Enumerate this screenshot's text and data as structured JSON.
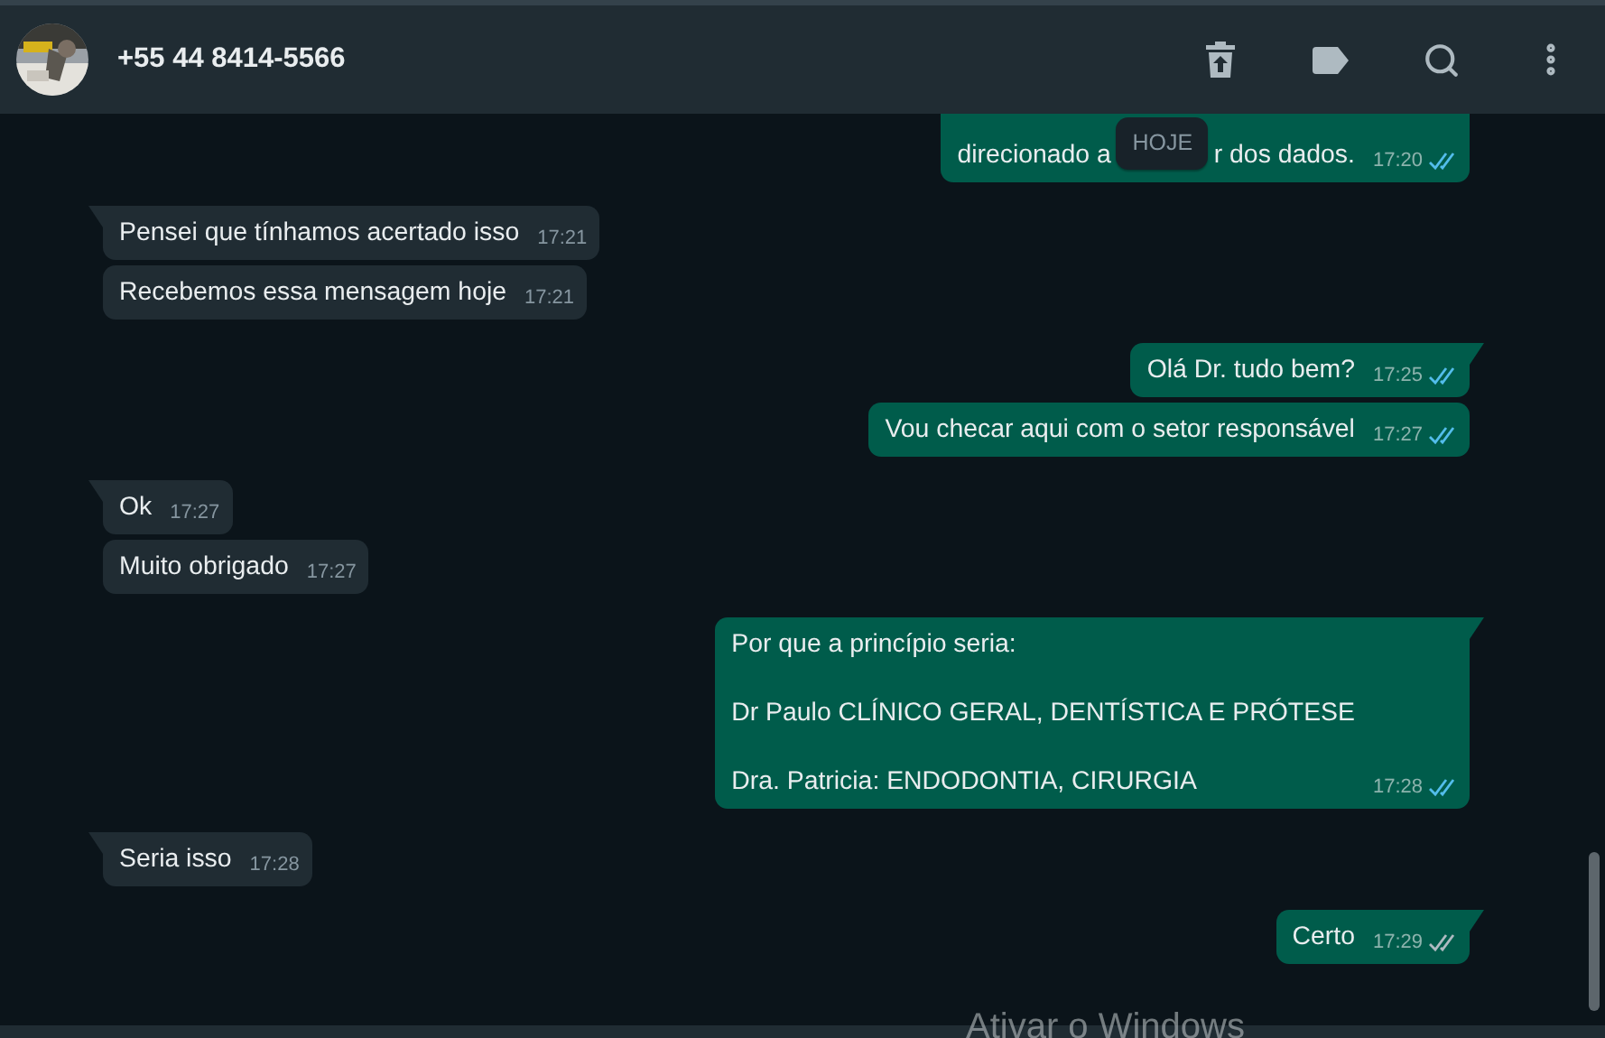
{
  "header": {
    "contact": "+55 44 8414-5566"
  },
  "date_chip": "HOJE",
  "messages": [
    {
      "kind": "covered",
      "outgoing": true,
      "before_chip": "direcionado a",
      "after_chip": "r dos dados.",
      "time": "17:20",
      "read": true
    },
    {
      "kind": "text",
      "outgoing": false,
      "text": "Pensei que tínhamos acertado isso",
      "time": "17:21"
    },
    {
      "kind": "text",
      "outgoing": false,
      "text": "Recebemos essa mensagem hoje",
      "time": "17:21"
    },
    {
      "kind": "text",
      "outgoing": true,
      "text": "Olá Dr. tudo bem?",
      "time": "17:25",
      "read": true
    },
    {
      "kind": "text",
      "outgoing": true,
      "text": "Vou checar aqui com o setor responsável",
      "time": "17:27",
      "read": true
    },
    {
      "kind": "text",
      "outgoing": false,
      "text": "Ok",
      "time": "17:27"
    },
    {
      "kind": "text",
      "outgoing": false,
      "text": "Muito obrigado",
      "time": "17:27"
    },
    {
      "kind": "text",
      "outgoing": true,
      "text": "Por que a princípio seria:\n\nDr Paulo CLÍNICO GERAL, DENTÍSTICA E PRÓTESE\n\nDra. Patricia: ENDODONTIA, CIRURGIA",
      "time": "17:28",
      "read": true
    },
    {
      "kind": "text",
      "outgoing": false,
      "text": "Seria isso",
      "time": "17:28"
    },
    {
      "kind": "text",
      "outgoing": true,
      "text": "Certo",
      "time": "17:29",
      "read": false
    }
  ],
  "os_notice": "Ativar o Windows"
}
